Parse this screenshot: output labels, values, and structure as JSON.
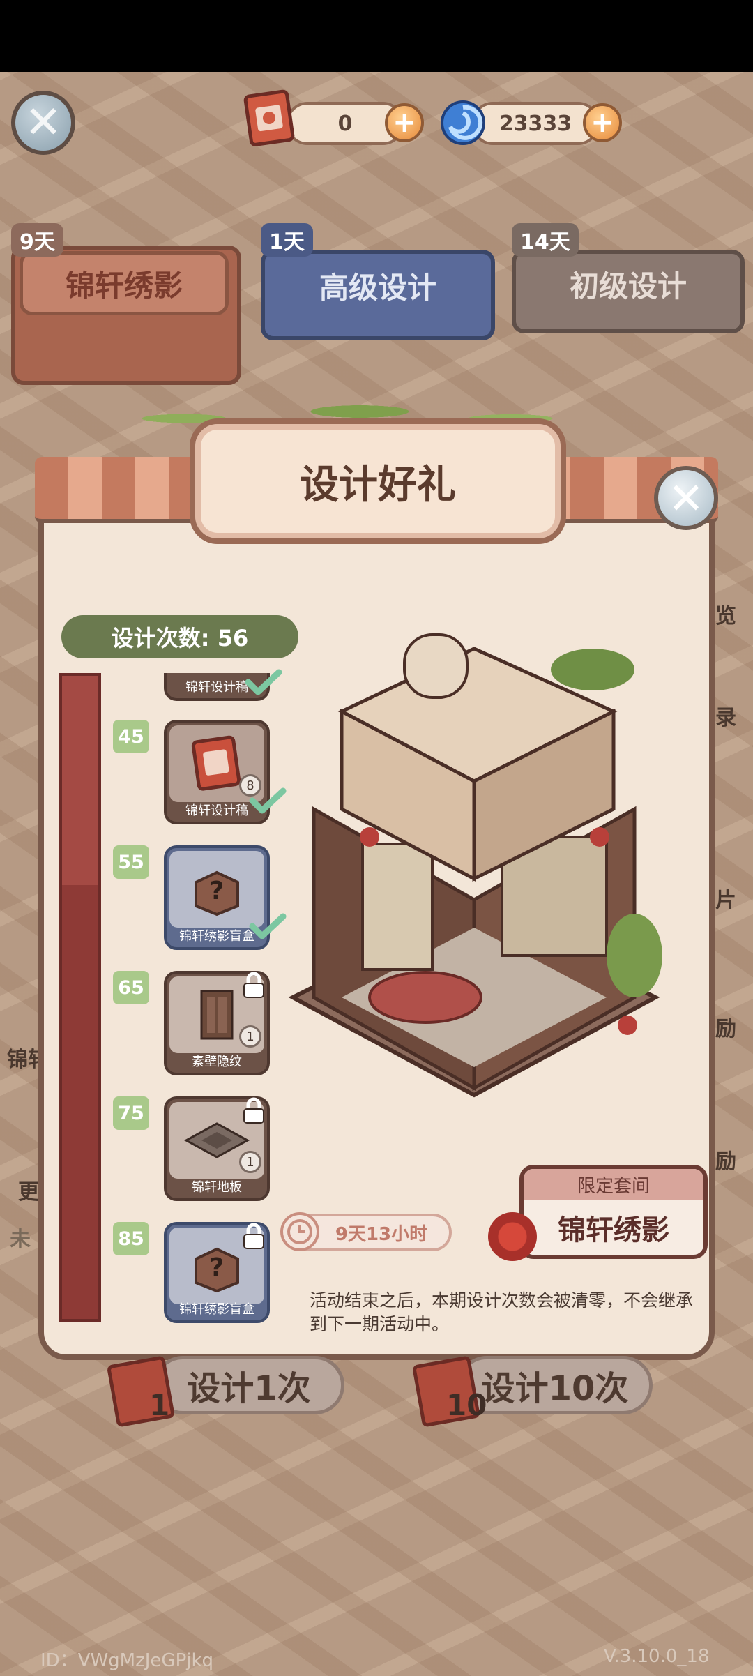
{
  "header": {
    "close_icon": "close-icon",
    "ticket": {
      "icon": "design-ticket-icon",
      "value": "0",
      "plus": "+"
    },
    "gem": {
      "icon": "swirl-gem-icon",
      "value": "23333",
      "plus": "+",
      "color": "#3f7fd4"
    }
  },
  "tabs": [
    {
      "days": "9天",
      "label": "锦轩绣影",
      "active": true
    },
    {
      "days": "1天",
      "label": "高级设计",
      "active": false
    },
    {
      "days": "14天",
      "label": "初级设计",
      "active": false
    }
  ],
  "side_labels": {
    "right": [
      "览",
      "录",
      "片",
      "励",
      "励"
    ],
    "left": [
      "锦轩",
      "更",
      "未"
    ]
  },
  "modal": {
    "title": "设计好礼",
    "design_count": "设计次数: 56",
    "milestones": [
      {
        "value": "45",
        "reward": "锦轩设计稿",
        "count": "8",
        "status": "claimed"
      },
      {
        "value": "55",
        "reward": "锦轩绣影盲盒",
        "count": "",
        "status": "claimed"
      },
      {
        "value": "65",
        "reward": "素壁隐纹",
        "count": "1",
        "status": "locked"
      },
      {
        "value": "75",
        "reward": "锦轩地板",
        "count": "1",
        "status": "locked"
      },
      {
        "value": "85",
        "reward": "锦轩绣影盲盒",
        "count": "",
        "status": "locked"
      }
    ],
    "top_partial_reward": "锦轩设计稿",
    "limited": {
      "header": "限定套间",
      "name": "锦轩绣影"
    },
    "timer": "9天13小时",
    "notice": "活动结束之后，本期设计次数会被清零，不会继承到下一期活动中。"
  },
  "actions": [
    {
      "label": "设计1次",
      "cost": "1"
    },
    {
      "label": "设计10次",
      "cost": "10"
    }
  ],
  "footer": {
    "id": "ID：VWgMzJeGPjkq",
    "version": "V.3.10.0_18"
  },
  "colors": {
    "accent_red": "#8e3a36",
    "pill_green": "#6b7a4f",
    "milestone_green": "#a9c98a",
    "check_green": "#7cc7a1"
  }
}
